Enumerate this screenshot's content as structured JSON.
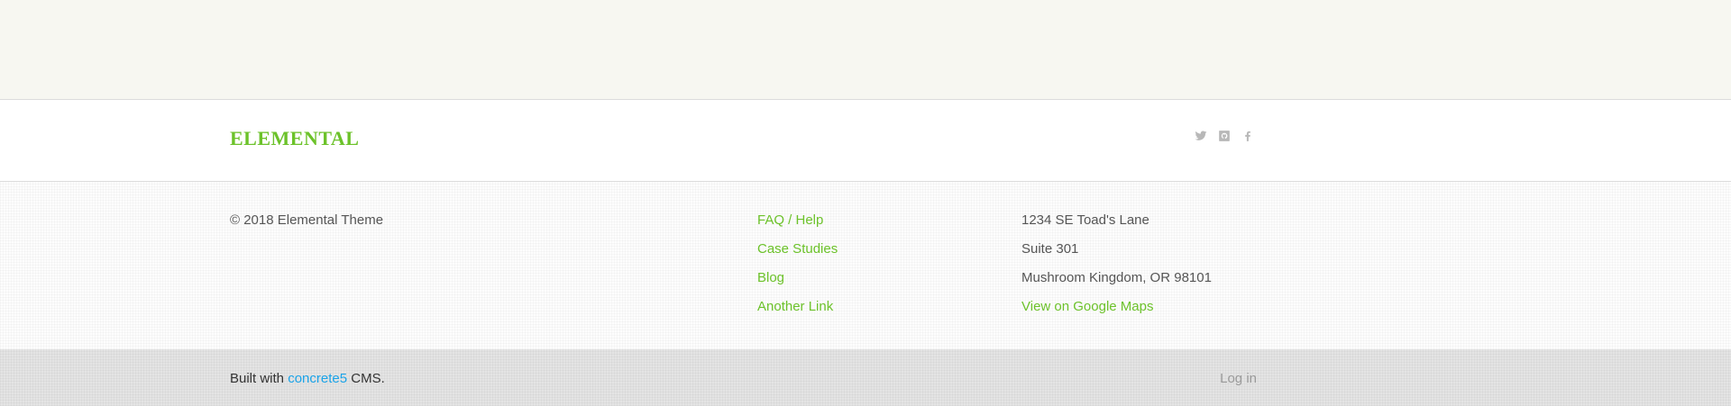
{
  "colors": {
    "accent": "#6cc22a",
    "link_blue": "#1aa3e8",
    "text": "#555555",
    "top_band": "#f7f7f1",
    "bottom_bar": "#e4e4e4"
  },
  "header": {
    "logo": "ELEMENTAL",
    "social": [
      {
        "icon": "twitter-icon"
      },
      {
        "icon": "github-icon"
      },
      {
        "icon": "facebook-icon"
      }
    ]
  },
  "footer": {
    "copyright": "© 2018 Elemental Theme",
    "links": [
      "FAQ / Help",
      "Case Studies",
      "Blog",
      "Another Link"
    ],
    "address": {
      "line1": "1234 SE Toad's Lane",
      "line2": "Suite 301",
      "line3": "Mushroom Kingdom, OR 98101",
      "maps_link": "View on Google Maps"
    }
  },
  "bottom": {
    "built_prefix": "Built with ",
    "cms_link": "concrete5",
    "built_suffix": " CMS.",
    "login": "Log in"
  }
}
